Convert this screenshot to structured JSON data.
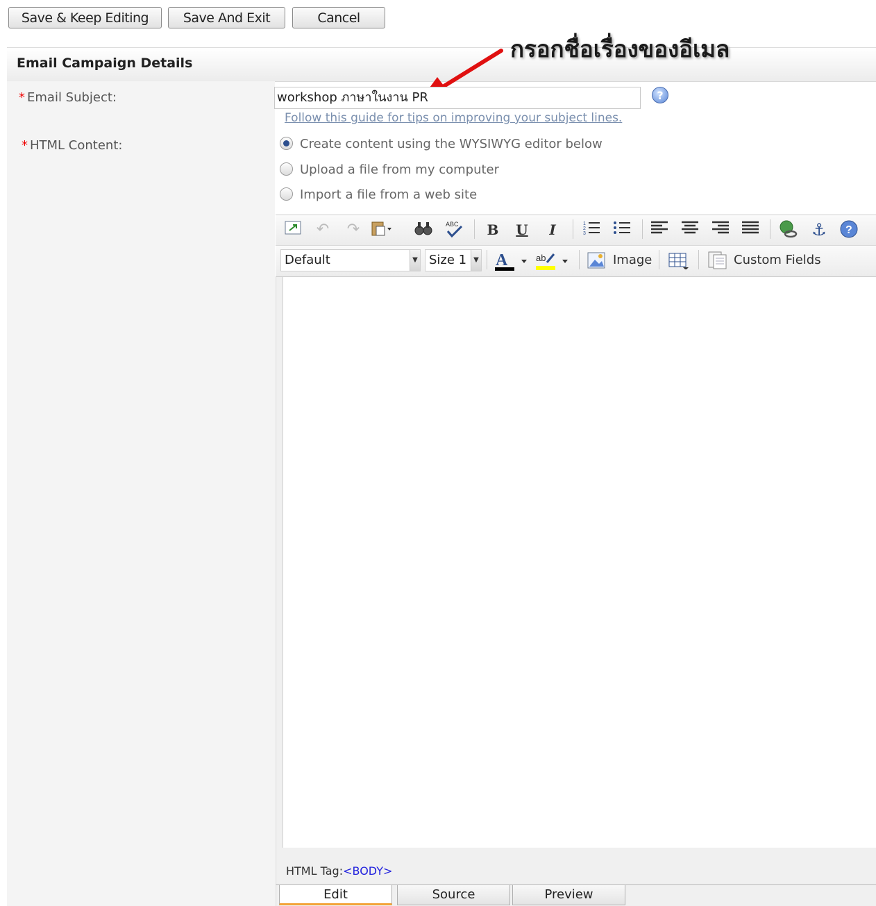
{
  "toolbar": {
    "save_keep_editing": "Save & Keep Editing",
    "save_and_exit": "Save And Exit",
    "cancel": "Cancel"
  },
  "annotation": "กรอกชื่อเรื่องของอีเมล",
  "section": {
    "title": "Email Campaign Details"
  },
  "subject": {
    "label": "Email Subject:",
    "required_mark": "*",
    "value": "workshop ภาษาในงาน PR",
    "help_symbol": "?",
    "guide_link": "Follow this guide for tips on improving your subject lines."
  },
  "html_content": {
    "label": "HTML Content:",
    "required_mark": "*",
    "options": [
      {
        "label": "Create content using the WYSIWYG editor below",
        "checked": true
      },
      {
        "label": "Upload a file from my computer",
        "checked": false
      },
      {
        "label": "Import a file from a web site",
        "checked": false
      }
    ]
  },
  "editor": {
    "font": "Default",
    "size": "Size 1",
    "image_label": "Image",
    "custom_fields_label": "Custom Fields",
    "status_prefix": "HTML Tag:",
    "status_tag": "<BODY>",
    "tabs": [
      "Edit",
      "Source",
      "Preview"
    ],
    "active_tab": "Edit"
  },
  "colors": {
    "required": "#ee0000",
    "link": "#7a8fae",
    "annotation_arrow": "#e01010",
    "active_tab_underline": "#f3a43a",
    "tag_text": "#2222dd"
  }
}
